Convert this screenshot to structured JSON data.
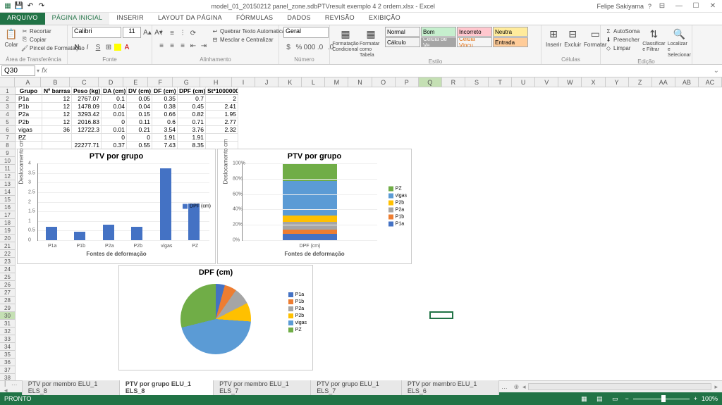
{
  "title": "model_01_20150212 panel_zone.sdbPTVresult exemplo 4 2 ordem.xlsx - Excel",
  "user": "Felipe Sakiyama",
  "tabs": {
    "file": "ARQUIVO",
    "home": "PÁGINA INICIAL",
    "insert": "INSERIR",
    "layout": "LAYOUT DA PÁGINA",
    "formulas": "FÓRMULAS",
    "data": "DADOS",
    "review": "REVISÃO",
    "view": "EXIBIÇÃO"
  },
  "ribbon": {
    "clipboard": {
      "paste": "Colar",
      "cut": "Recortar",
      "copy": "Copiar",
      "painter": "Pincel de Formatação",
      "label": "Área de Transferência"
    },
    "font": {
      "name": "Calibri",
      "size": "11",
      "label": "Fonte"
    },
    "align": {
      "wrap": "Quebrar Texto Automaticamente",
      "merge": "Mesclar e Centralizar",
      "label": "Alinhamento"
    },
    "number": {
      "format": "Geral",
      "label": "Número"
    },
    "stylesg": {
      "cond": "Formatação Condicional",
      "table": "Formatar como Tabela",
      "label": "Estilo"
    },
    "styles": {
      "normal": "Normal",
      "bom": "Bom",
      "incorreto": "Incorreto",
      "neutra": "Neutra",
      "calculo": "Cálculo",
      "celver": "Célula de Ve...",
      "celvin": "Célula Vincu...",
      "entrada": "Entrada"
    },
    "cells": {
      "insert": "Inserir",
      "delete": "Excluir",
      "format": "Formatar",
      "label": "Células"
    },
    "editing": {
      "sum": "AutoSoma",
      "fill": "Preencher",
      "clear": "Limpar",
      "sort": "Classificar e Filtrar",
      "find": "Localizar e Selecionar",
      "label": "Edição"
    }
  },
  "name_box": "Q30",
  "columns": [
    "A",
    "B",
    "C",
    "D",
    "E",
    "F",
    "G",
    "H",
    "I",
    "J",
    "K",
    "L",
    "M",
    "N",
    "O",
    "P",
    "Q",
    "R",
    "S",
    "T",
    "U",
    "V",
    "W",
    "X",
    "Y",
    "Z",
    "AA",
    "AB",
    "AC"
  ],
  "headers": [
    "Grupo",
    "Nº barras",
    "Peso (kg)",
    "DA (cm)",
    "DV (cm)",
    "DF (cm)",
    "DPF (cm)",
    "St*1000000"
  ],
  "rows": [
    [
      "P1a",
      "12",
      "2767.07",
      "0.1",
      "0.05",
      "0.35",
      "0.7",
      "2"
    ],
    [
      "P1b",
      "12",
      "1478.09",
      "0.04",
      "0.04",
      "0.38",
      "0.45",
      "2.41"
    ],
    [
      "P2a",
      "12",
      "3293.42",
      "0.01",
      "0.15",
      "0.66",
      "0.82",
      "1.95"
    ],
    [
      "P2b",
      "12",
      "2016.83",
      "0",
      "0.11",
      "0.6",
      "0.71",
      "2.77"
    ],
    [
      "vigas",
      "36",
      "12722.3",
      "0.01",
      "0.21",
      "3.54",
      "3.76",
      "2.32"
    ],
    [
      "PZ",
      "",
      "",
      "0",
      "0",
      "1.91",
      "1.91",
      ""
    ],
    [
      "",
      "",
      "22277.71",
      "0.37",
      "0.55",
      "7.43",
      "8.35",
      ""
    ]
  ],
  "chart_data": [
    {
      "type": "bar",
      "title": "PTV por grupo",
      "categories": [
        "P1a",
        "P1b",
        "P2a",
        "P2b",
        "vigas",
        "PZ"
      ],
      "series": [
        {
          "name": "DPF (cm)",
          "values": [
            0.7,
            0.45,
            0.82,
            0.71,
            3.76,
            1.91
          ]
        }
      ],
      "ylabel": "Deslocamento cm",
      "xlabel": "Fontes de deformação",
      "ylim": [
        0,
        4
      ],
      "yticks": [
        0,
        0.5,
        1,
        1.5,
        2,
        2.5,
        3,
        3.5,
        4
      ]
    },
    {
      "type": "bar_stacked_100",
      "title": "PTV por grupo",
      "categories": [
        "DPF (cm)"
      ],
      "series": [
        {
          "name": "P1a",
          "values": [
            0.7
          ],
          "color": "#4472c4"
        },
        {
          "name": "P1b",
          "values": [
            0.45
          ],
          "color": "#ed7d31"
        },
        {
          "name": "P2a",
          "values": [
            0.82
          ],
          "color": "#a5a5a5"
        },
        {
          "name": "P2b",
          "values": [
            0.71
          ],
          "color": "#ffc000"
        },
        {
          "name": "vigas",
          "values": [
            3.76
          ],
          "color": "#5b9bd5"
        },
        {
          "name": "PZ",
          "values": [
            1.91
          ],
          "color": "#70ad47"
        }
      ],
      "ylabel": "Deslocamento cm",
      "xlabel": "Fontes de deformação",
      "ylim": [
        0,
        100
      ],
      "yticks": [
        "0%",
        "20%",
        "40%",
        "60%",
        "80%",
        "100%"
      ]
    },
    {
      "type": "pie",
      "title": "DPF (cm)",
      "labels": [
        "P1a",
        "P1b",
        "P2a",
        "P2b",
        "vigas",
        "PZ"
      ],
      "values": [
        0.35,
        0.45,
        0.66,
        0.71,
        3.76,
        2.41
      ],
      "colors": [
        "#4472c4",
        "#ed7d31",
        "#a5a5a5",
        "#ffc000",
        "#5b9bd5",
        "#70ad47"
      ]
    }
  ],
  "sheets": {
    "active": "PTV por grupo ELU_1 ELS_8",
    "others": [
      "PTV por membro ELU_1 ELS_8",
      "PTV por membro ELU_1 ELS_7",
      "PTV por grupo ELU_1 ELS_7",
      "PTV por membro ELU_1 ELS_6"
    ]
  },
  "status": {
    "ready": "PRONTO",
    "zoom": "100%"
  }
}
